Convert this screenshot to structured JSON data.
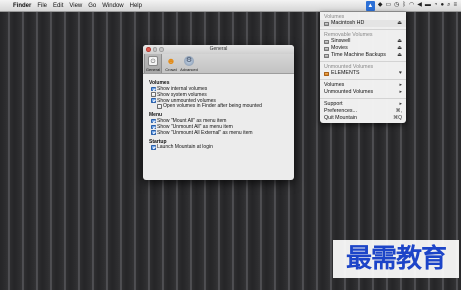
{
  "menubar": {
    "apple_glyph": "",
    "app_name": "Finder",
    "menus": [
      "File",
      "Edit",
      "View",
      "Go",
      "Window",
      "Help"
    ],
    "status_icons": {
      "mountain": "mountain-status-icon",
      "others": [
        "dropbox-icon",
        "monitor-icon",
        "timemachine-icon",
        "bluetooth-icon",
        "wifi-icon",
        "volume-icon",
        "battery-icon",
        "clock-icon",
        "user-icon",
        "spotlight-icon",
        "notification-icon"
      ]
    }
  },
  "dropdown": {
    "volumes_header": "Volumes",
    "volumes": [
      {
        "label": "Macintosh HD",
        "glyph": "⏏"
      }
    ],
    "removable_header": "Removable Volumes",
    "removable": [
      {
        "label": "Sinswell",
        "glyph": "⏏"
      },
      {
        "label": "Movies",
        "glyph": "⏏"
      },
      {
        "label": "Time Machine Backups",
        "glyph": "⏏"
      }
    ],
    "unmounted_header": "Unmounted Volumes",
    "unmounted": [
      {
        "label": "ELEMENTS",
        "glyph": "♥"
      }
    ],
    "menus": [
      {
        "label": "Volumes",
        "glyph": "▸"
      },
      {
        "label": "Unmounted Volumes",
        "glyph": "▸"
      }
    ],
    "bottom": [
      {
        "label": "Support",
        "glyph": "▸"
      },
      {
        "label": "Preferences...",
        "glyph": "⌘,"
      },
      {
        "label": "Quit Mountain",
        "glyph": "⌘Q"
      }
    ]
  },
  "window": {
    "title": "General",
    "tabs": [
      {
        "label": "General",
        "icon": "switch-icon"
      },
      {
        "label": "Crowd",
        "icon": "crowd-icon"
      },
      {
        "label": "Advanced",
        "icon": "gear-icon"
      }
    ],
    "sections": {
      "volumes": {
        "title": "Volumes",
        "options": [
          {
            "label": "Show internal volumes",
            "checked": true
          },
          {
            "label": "Show system volumes",
            "checked": false
          },
          {
            "label": "Show unmounted volumes",
            "checked": true
          },
          {
            "label": "Open volumes in Finder after being mounted",
            "checked": false
          }
        ]
      },
      "menu": {
        "title": "Menu",
        "options": [
          {
            "label": "Show \"Mount All\" as menu item",
            "checked": true
          },
          {
            "label": "Show \"Unmount All\" as menu item",
            "checked": true
          },
          {
            "label": "Show \"Unmount All External\" as menu item",
            "checked": true
          }
        ]
      },
      "startup": {
        "title": "Startup",
        "options": [
          {
            "label": "Launch Mountain at login",
            "checked": true
          }
        ]
      }
    }
  },
  "watermark": "最需教育",
  "colors": {
    "selection_blue": "#2f77d9",
    "mountain_status_blue": "#2b6fd6",
    "watermark_blue": "#1c44c8"
  }
}
